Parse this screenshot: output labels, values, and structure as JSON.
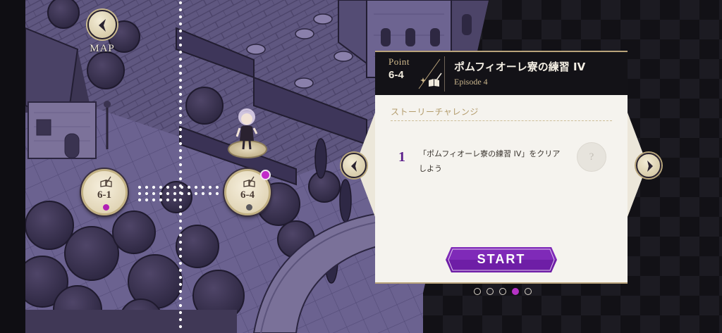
{
  "map": {
    "back_label": "MAP",
    "nodes": [
      {
        "label": "6-1",
        "dot_color": "#b11fb4"
      },
      {
        "label": "6-4",
        "dot_color": "#5c5a5e"
      }
    ],
    "notification_color": "#c12bc9"
  },
  "panel": {
    "point_label": "Point",
    "point_number": "6-4",
    "title": "ポムフィオーレ寮の練習 IV",
    "subtitle": "Episode 4",
    "section_title": "ストーリーチャレンジ",
    "challenge": {
      "number": "1",
      "text": "「ポムフィオーレ寮の練習 IV」をクリアしよう",
      "reward_placeholder": "?"
    },
    "start_label": "START",
    "start_color": "#6e1ea6"
  },
  "pager": {
    "count": 5,
    "active_index": 3,
    "active_color": "#b532c5"
  },
  "icons": [
    "chevron-left-icon",
    "chevron-right-icon",
    "quill-book-icon"
  ]
}
